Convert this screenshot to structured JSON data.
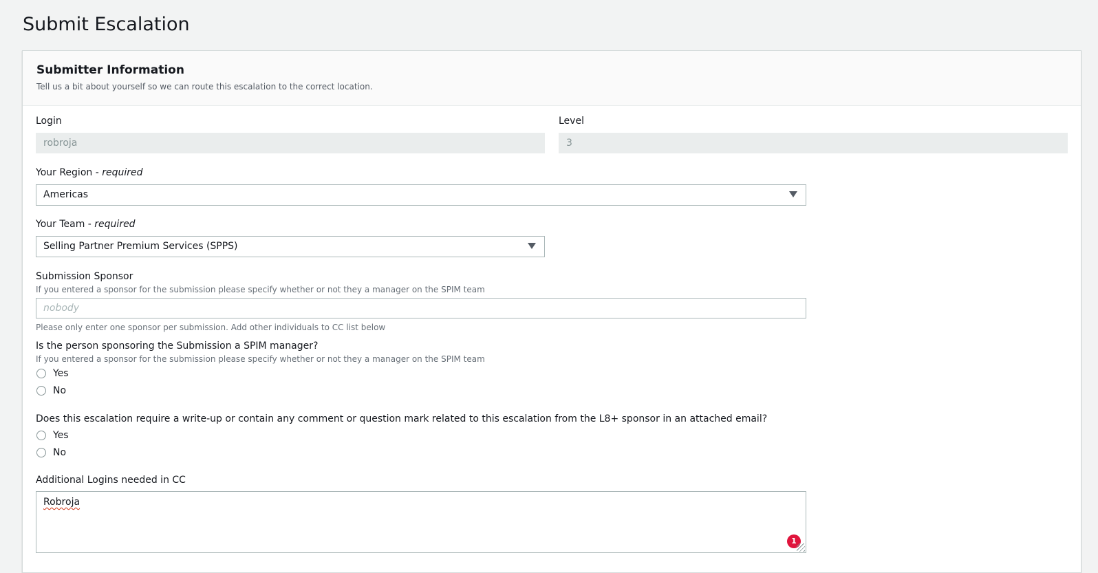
{
  "page": {
    "title": "Submit Escalation"
  },
  "section": {
    "title": "Submitter Information",
    "description": "Tell us a bit about yourself so we can route this escalation to the correct location."
  },
  "fields": {
    "login": {
      "label": "Login",
      "value": "robroja"
    },
    "level": {
      "label": "Level",
      "value": "3"
    },
    "region": {
      "label": "Your Region - ",
      "required": "required",
      "value": "Americas"
    },
    "team": {
      "label": "Your Team - ",
      "required": "required",
      "value": "Selling Partner Premium Services (SPPS)"
    },
    "sponsor": {
      "label": "Submission Sponsor",
      "description": "If you entered a sponsor for the submission please specify whether or not they a manager on the SPIM team",
      "placeholder": "nobody",
      "hint": "Please only enter one sponsor per submission. Add other individuals to CC list below"
    },
    "sponsor_manager": {
      "label": "Is the person sponsoring the Submission a SPIM manager?",
      "description": "If you entered a sponsor for the submission please specify whether or not they a manager on the SPIM team",
      "options": [
        "Yes",
        "No"
      ]
    },
    "writeup": {
      "label": "Does this escalation require a write-up or contain any comment or question mark related to this escalation from the L8+ sponsor in an attached email?",
      "options": [
        "Yes",
        "No"
      ]
    },
    "cc": {
      "label": "Additional Logins needed in CC",
      "value": "Robroja",
      "badge": "1"
    }
  }
}
